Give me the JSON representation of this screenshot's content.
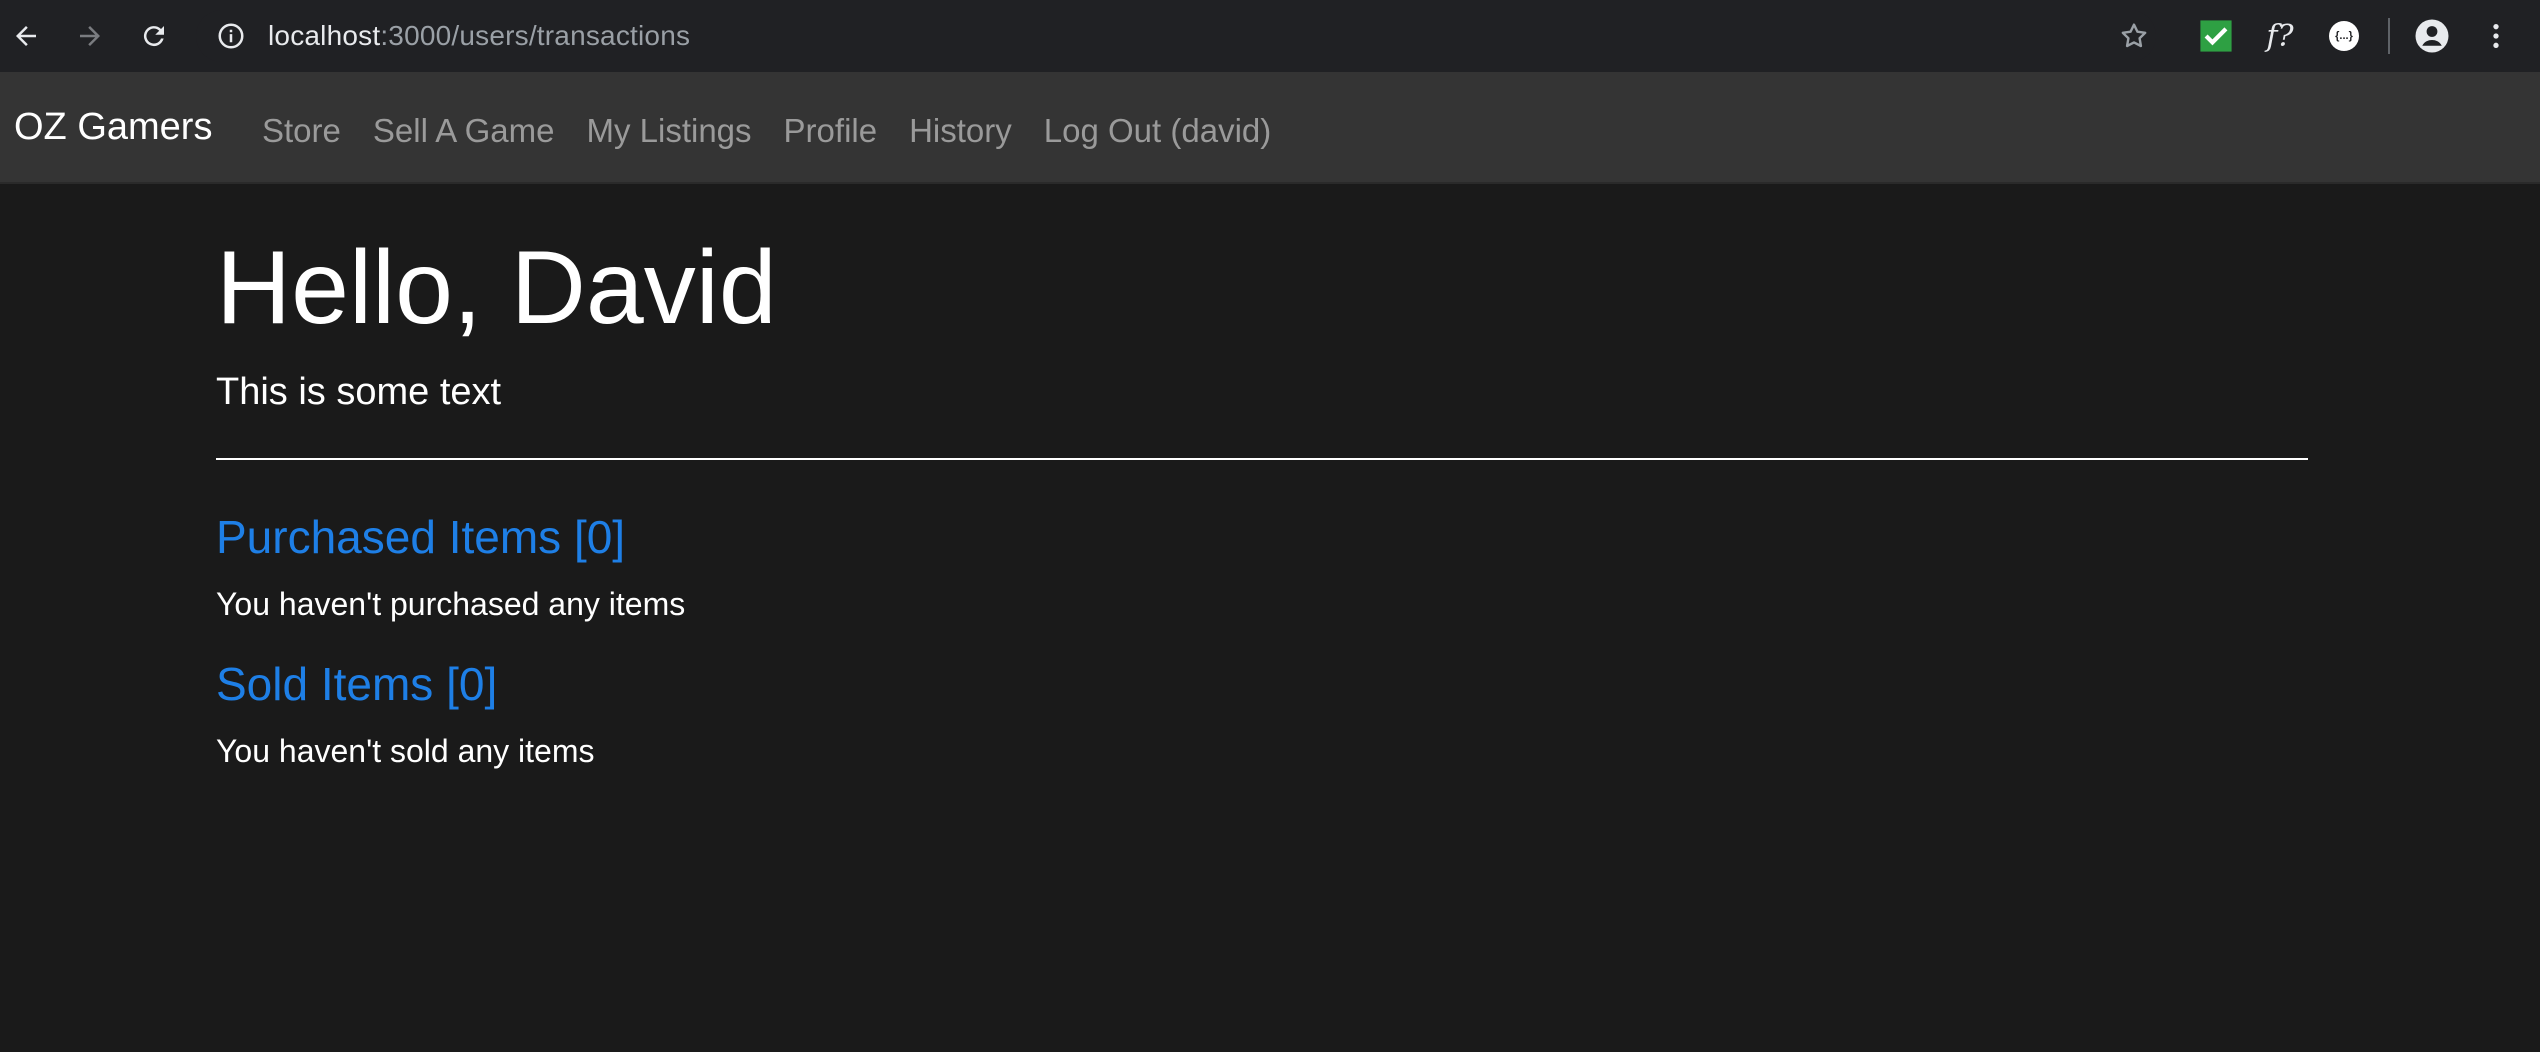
{
  "browser": {
    "url_host": "localhost",
    "url_path": ":3000/users/transactions",
    "icons": [
      "back-arrow-icon",
      "forward-arrow-icon",
      "reload-icon",
      "info-icon",
      "star-icon",
      "green-check-extension-icon",
      "font-extension-icon",
      "json-extension-icon",
      "account-icon",
      "menu-dots-icon"
    ],
    "ext_font_label": "f?",
    "ext_json_label": "{...}"
  },
  "navbar": {
    "brand": "OZ Gamers",
    "links": [
      "Store",
      "Sell A Game",
      "My Listings",
      "Profile",
      "History",
      "Log Out (david)"
    ]
  },
  "main": {
    "greeting": "Hello, David",
    "subtext": "This is some text",
    "purchased": {
      "title": "Purchased Items [0]",
      "message": "You haven't purchased any items"
    },
    "sold": {
      "title": "Sold Items [0]",
      "message": "You haven't sold any items"
    }
  },
  "colors": {
    "page_bg": "#1a1a1a",
    "navbar_bg": "#343434",
    "link_accent": "#1e7fe6",
    "nav_text": "#9a9a9a"
  }
}
